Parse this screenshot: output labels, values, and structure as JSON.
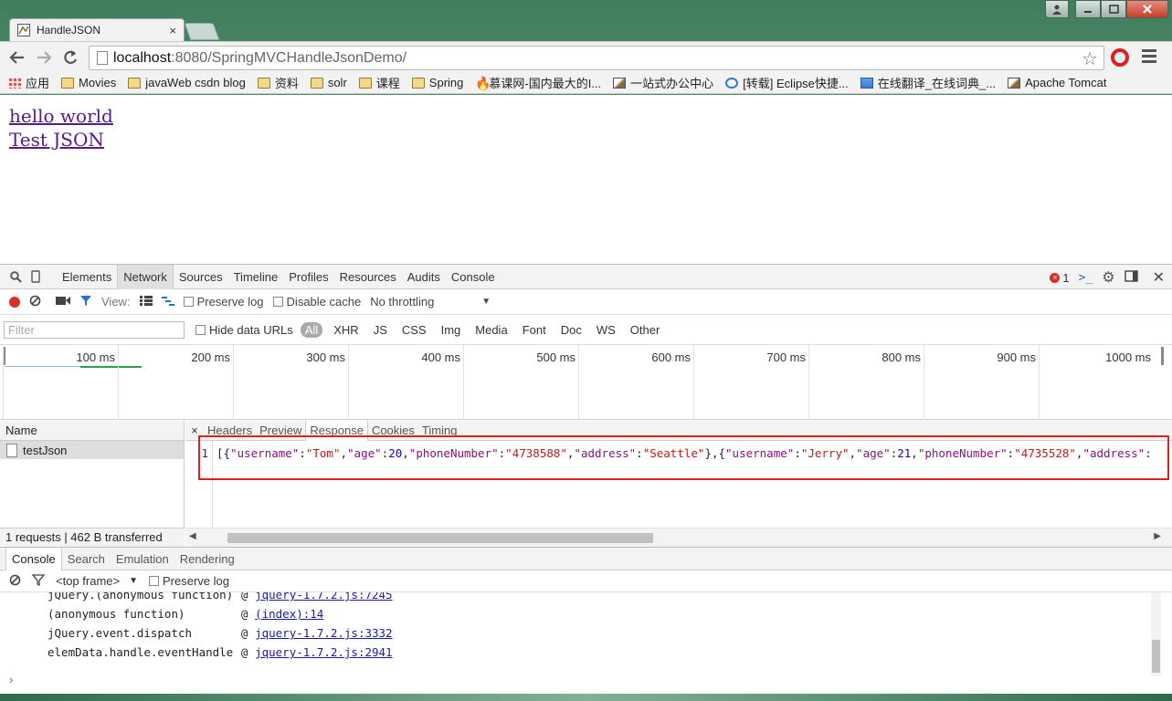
{
  "window": {
    "tab_title": "HandleJSON",
    "tab_close": "×"
  },
  "toolbar": {
    "url_host": "localhost",
    "url_path": ":8080/SpringMVCHandleJsonDemo/"
  },
  "bookmarks": [
    {
      "label": "应用",
      "icon": "apps"
    },
    {
      "label": "Movies",
      "icon": "folder"
    },
    {
      "label": "javaWeb csdn blog",
      "icon": "folder"
    },
    {
      "label": "资料",
      "icon": "folder"
    },
    {
      "label": "solr",
      "icon": "folder"
    },
    {
      "label": "课程",
      "icon": "folder"
    },
    {
      "label": "Spring",
      "icon": "folder"
    },
    {
      "label": "慕课网-国内最大的I...",
      "icon": "fire"
    },
    {
      "label": "一站式办公中心",
      "icon": "img"
    },
    {
      "label": "[转载] Eclipse快捷...",
      "icon": "blue"
    },
    {
      "label": "在线翻译_在线词典_...",
      "icon": "photo"
    },
    {
      "label": "Apache Tomcat",
      "icon": "img"
    }
  ],
  "page": {
    "link1": "hello world",
    "link2": "Test JSON"
  },
  "devtools": {
    "tabs": [
      "Elements",
      "Network",
      "Sources",
      "Timeline",
      "Profiles",
      "Resources",
      "Audits",
      "Console"
    ],
    "active_tab": "Network",
    "error_count": "1",
    "net_bar": {
      "view_label": "View:",
      "preserve_log": "Preserve log",
      "disable_cache": "Disable cache",
      "throttling": "No throttling"
    },
    "filter": {
      "placeholder": "Filter",
      "hide_data_urls": "Hide data URLs",
      "types": [
        "All",
        "XHR",
        "JS",
        "CSS",
        "Img",
        "Media",
        "Font",
        "Doc",
        "WS",
        "Other"
      ]
    },
    "overview_ticks": [
      "100 ms",
      "200 ms",
      "300 ms",
      "400 ms",
      "500 ms",
      "600 ms",
      "700 ms",
      "800 ms",
      "900 ms",
      "1000 ms"
    ],
    "requests": {
      "header": "Name",
      "rows": [
        "testJson"
      ],
      "footer": "1 requests  |  462 B transferred"
    },
    "detail_tabs": [
      "Headers",
      "Preview",
      "Response",
      "Cookies",
      "Timing"
    ],
    "active_detail_tab": "Response",
    "response": {
      "line_number": "1",
      "records": [
        {
          "username": "Tom",
          "age": 20,
          "phoneNumber": "4738588",
          "address": "Seattle"
        },
        {
          "username": "Jerry",
          "age": 21,
          "phoneNumber": "4735528",
          "address": ""
        }
      ]
    },
    "drawer": {
      "tabs": [
        "Console",
        "Search",
        "Emulation",
        "Rendering"
      ],
      "active": "Console",
      "frame": "<top frame>",
      "preserve_log": "Preserve log",
      "trace": [
        {
          "fn": "jQuery.(anonymous function)",
          "at": "@",
          "src": "jquery-1.7.2.js:7245"
        },
        {
          "fn": "(anonymous function)",
          "at": "@",
          "src": "(index):14"
        },
        {
          "fn": "jQuery.event.dispatch",
          "at": "@",
          "src": "jquery-1.7.2.js:3332"
        },
        {
          "fn": "elemData.handle.eventHandle",
          "at": "@",
          "src": "jquery-1.7.2.js:2941"
        }
      ],
      "prompt": "›"
    }
  }
}
